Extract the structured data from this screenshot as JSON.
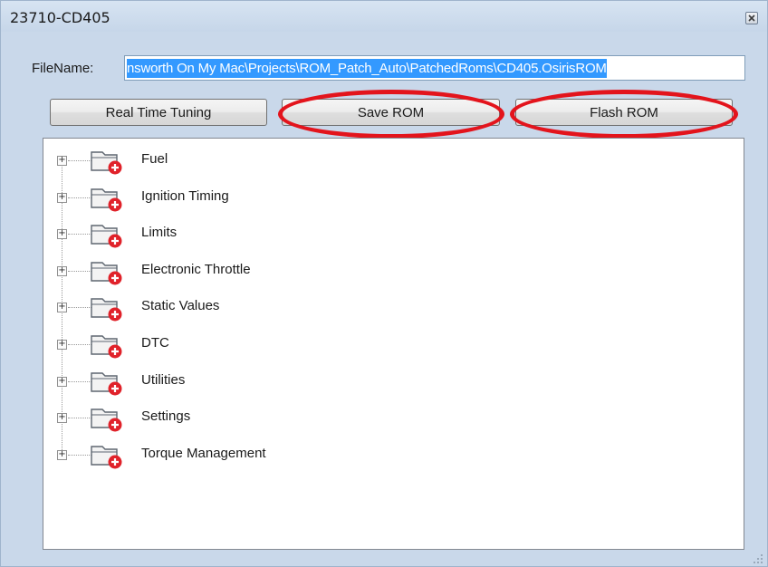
{
  "window": {
    "title": "23710-CD405"
  },
  "filename": {
    "label": "FileName:",
    "value": "nsworth On My Mac\\Projects\\ROM_Patch_Auto\\PatchedRoms\\CD405.OsirisROM"
  },
  "buttons": {
    "real_time_tuning": "Real Time Tuning",
    "save_rom": "Save ROM",
    "flash_rom": "Flash ROM"
  },
  "tree": {
    "items": [
      {
        "label": "Fuel"
      },
      {
        "label": "Ignition Timing"
      },
      {
        "label": "Limits"
      },
      {
        "label": "Electronic Throttle"
      },
      {
        "label": "Static Values"
      },
      {
        "label": "DTC"
      },
      {
        "label": "Utilities"
      },
      {
        "label": "Settings"
      },
      {
        "label": "Torque Management"
      }
    ],
    "expander_glyph": "+",
    "icon": "folder-with-red-badge-icon"
  },
  "colors": {
    "window_bg": "#c9d8ea",
    "selection": "#3399ff",
    "annotation_red": "#e3141c"
  }
}
